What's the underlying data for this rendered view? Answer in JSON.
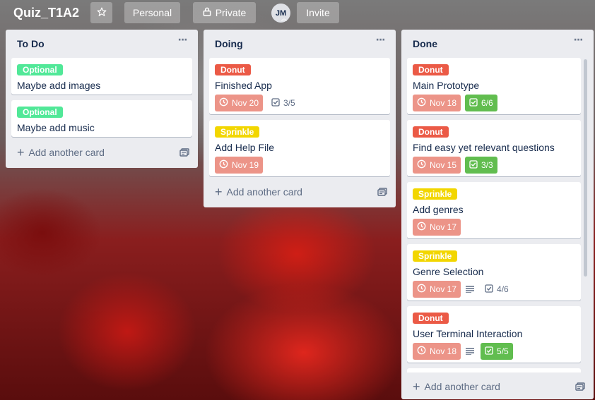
{
  "board": {
    "title": "Quiz_T1A2",
    "visibility_team": "Personal",
    "visibility": "Private",
    "member_initials": "JM",
    "invite_label": "Invite"
  },
  "colors": {
    "label_optional": "#51e898",
    "label_donut": "#eb5a46",
    "label_sprinkle": "#f2d600",
    "due_overdue": "#ec9488",
    "checklist_complete": "#61bd4f"
  },
  "lists": [
    {
      "title": "To Do",
      "add_label": "Add another card",
      "cards": [
        {
          "label": "Optional",
          "label_color": "#51e898",
          "title": "Maybe add images"
        },
        {
          "label": "Optional",
          "label_color": "#51e898",
          "title": "Maybe add music"
        }
      ]
    },
    {
      "title": "Doing",
      "add_label": "Add another card",
      "cards": [
        {
          "label": "Donut",
          "label_color": "#eb5a46",
          "title": "Finished App",
          "due": "Nov 20",
          "checklist": "3/5",
          "checklist_complete": false,
          "has_description": false
        },
        {
          "label": "Sprinkle",
          "label_color": "#f2d600",
          "title": "Add Help File",
          "due": "Nov 19"
        }
      ]
    },
    {
      "title": "Done",
      "add_label": "Add another card",
      "cards": [
        {
          "label": "Donut",
          "label_color": "#eb5a46",
          "title": "Main Prototype",
          "due": "Nov 18",
          "checklist": "6/6",
          "checklist_complete": true
        },
        {
          "label": "Donut",
          "label_color": "#eb5a46",
          "title": "Find easy yet relevant questions",
          "due": "Nov 15",
          "checklist": "3/3",
          "checklist_complete": true
        },
        {
          "label": "Sprinkle",
          "label_color": "#f2d600",
          "title": "Add genres",
          "due": "Nov 17"
        },
        {
          "label": "Sprinkle",
          "label_color": "#f2d600",
          "title": "Genre Selection",
          "due": "Nov 17",
          "has_description": true,
          "checklist": "4/6",
          "checklist_complete": false
        },
        {
          "label": "Donut",
          "label_color": "#eb5a46",
          "title": "User Terminal Interaction",
          "due": "Nov 18",
          "has_description": true,
          "checklist": "5/5",
          "checklist_complete": true
        }
      ]
    }
  ]
}
